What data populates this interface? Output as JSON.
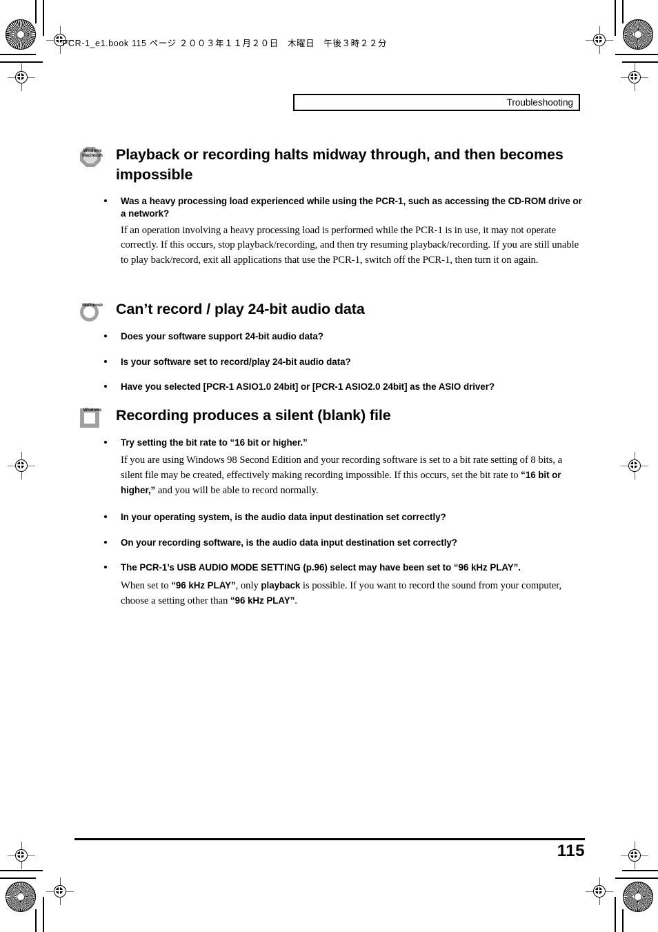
{
  "print_marks": {
    "file_header": "PCR-1_e1.book  115 ページ  ２００３年１１月２０日　木曜日　午後３時２２分"
  },
  "header": {
    "crumb": "Troubleshooting"
  },
  "sections": [
    {
      "badge": {
        "icon": "octagon-badge",
        "caption_line1": "Windows",
        "caption_line2": "Macintosh"
      },
      "title": "Playback or recording halts midway through, and then becomes impossible",
      "blocks": [
        {
          "bullet": "Was a heavy processing load experienced while using the PCR-1, such as accessing the CD-ROM drive or a network?",
          "body": "If an operation involving a heavy processing load is performed while the PCR-1 is in use, it may not operate correctly. If this occurs, stop playback/recording, and then try resuming playback/recording. If you are still unable to play back/record, exit all applications that use the PCR-1, switch off the PCR-1, then turn it on again."
        }
      ]
    },
    {
      "badge": {
        "icon": "circle-ring-badge",
        "caption_line1": "Macintosh",
        "caption_line2": ""
      },
      "title": "Can’t record / play 24-bit audio data",
      "blocks": [
        {
          "bullet": "Does your software support 24-bit audio data?",
          "body": ""
        },
        {
          "bullet": "Is your software set to record/play 24-bit audio data?",
          "body": ""
        },
        {
          "bullet": "Have you selected [PCR-1 ASIO1.0 24bit] or [PCR-1 ASIO2.0 24bit] as the ASIO driver?",
          "body": ""
        }
      ]
    },
    {
      "badge": {
        "icon": "square-outline-badge",
        "caption_line1": "Windows",
        "caption_line2": ""
      },
      "title": "Recording produces a silent (blank) file",
      "blocks": [
        {
          "bullet": "Try setting the bit rate to “16 bit or higher.”",
          "body_runs": [
            {
              "text": "If you are using Windows 98 Second Edition and your recording software is set to a bit rate setting of 8 bits, a silent file may be created, effectively making recording impossible. If this occurs, set the bit rate to ",
              "bold": false
            },
            {
              "text": "“16 bit or higher,”",
              "bold": true
            },
            {
              "text": " and you will be able to record normally.",
              "bold": false
            }
          ]
        },
        {
          "bullet": "In your operating system, is the audio data input destination set correctly?",
          "body": ""
        },
        {
          "bullet": "On your recording software, is the audio data input destination set correctly?",
          "body": ""
        },
        {
          "bullet": "The PCR-1’s USB AUDIO MODE SETTING (p.96) select may have been set to “96 kHz PLAY”.",
          "body_runs": [
            {
              "text": "When set to ",
              "bold": false
            },
            {
              "text": "“96 kHz PLAY”",
              "bold": true
            },
            {
              "text": ", only ",
              "bold": false
            },
            {
              "text": "playback",
              "bold": true
            },
            {
              "text": " is possible. If you want to record the sound from your computer, choose a setting other than ",
              "bold": false
            },
            {
              "text": "“96 kHz PLAY”",
              "bold": true
            },
            {
              "text": ".",
              "bold": false
            }
          ]
        }
      ]
    }
  ],
  "footer": {
    "page_number": "115"
  },
  "colors": {
    "badge_gray": "#9a9a9a",
    "text_black": "#000000",
    "rule_black": "#000000"
  }
}
